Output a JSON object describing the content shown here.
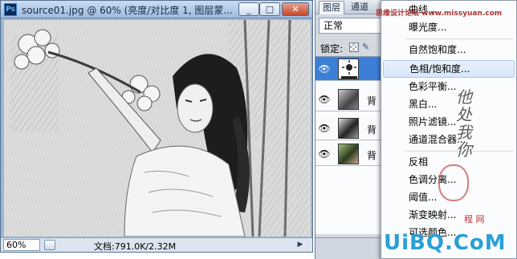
{
  "document": {
    "app_icon_text": "Ps",
    "title": "source01.jpg @ 60% (亮度/对比度 1, 图层蒙...",
    "buttons": {
      "minimize": "_",
      "maximize": "□",
      "close": "✕"
    },
    "zoom": "60%",
    "doc_info": "文档:791.0K/2.32M",
    "scroll_arrow": "▶"
  },
  "layers_panel": {
    "tabs": [
      "图层",
      "通道"
    ],
    "blend_mode": "正常",
    "lock_label": "锁定:",
    "lock_paint_icon": "✎",
    "layers": [
      {
        "name": "",
        "type": "adjustment",
        "selected": true,
        "visible": true
      },
      {
        "name": "背",
        "type": "image",
        "selected": false,
        "visible": true
      },
      {
        "name": "背",
        "type": "image",
        "selected": false,
        "visible": true
      },
      {
        "name": "背",
        "type": "image",
        "selected": false,
        "visible": true
      }
    ],
    "eye_icon": "👁"
  },
  "adjustments_menu": {
    "items": [
      {
        "label": "曲线...",
        "hover": false
      },
      {
        "label": "曝光度...",
        "hover": false
      },
      {
        "label": "自然饱和度...",
        "hover": false
      },
      {
        "label": "色相/饱和度...",
        "hover": true
      },
      {
        "label": "色彩平衡...",
        "hover": false
      },
      {
        "label": "黑白...",
        "hover": false
      },
      {
        "label": "照片滤镜...",
        "hover": false
      },
      {
        "label": "通道混合器...",
        "hover": false
      },
      {
        "label": "反相",
        "hover": false
      },
      {
        "label": "色调分离...",
        "hover": false
      },
      {
        "label": "阈值...",
        "hover": false
      },
      {
        "label": "渐变映射...",
        "hover": false
      },
      {
        "label": "可选颜色...",
        "hover": false
      }
    ]
  },
  "watermarks": {
    "top": "思缘设计论坛 www.missyuan.com",
    "signature": "他处我你",
    "cn": "程 网",
    "brand": "UiBQ.CoM",
    "domain": ""
  },
  "colors": {
    "selection": "#3d7fd6",
    "menu_hover": "#d6e6fa",
    "brand_blue": "#2a9fd6"
  }
}
